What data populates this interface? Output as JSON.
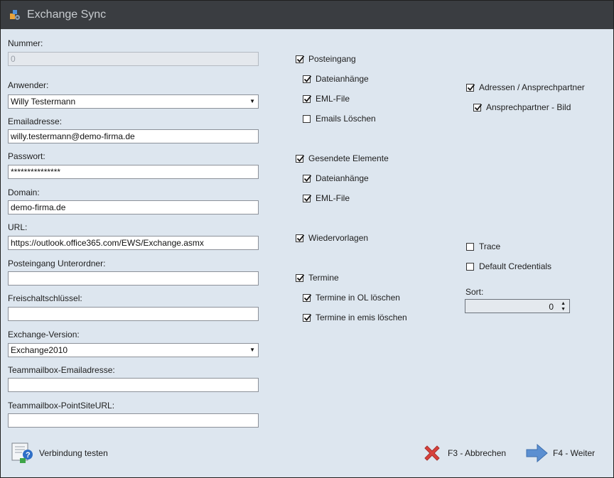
{
  "window": {
    "title": "Exchange Sync"
  },
  "form": {
    "nummer": {
      "label": "Nummer:",
      "value": "0"
    },
    "anwender": {
      "label": "Anwender:",
      "value": "Willy Testermann"
    },
    "email": {
      "label": "Emailadresse:",
      "value": "willy.testermann@demo-firma.de"
    },
    "passwort": {
      "label": "Passwort:",
      "value": "***************"
    },
    "domain": {
      "label": "Domain:",
      "value": "demo-firma.de"
    },
    "url": {
      "label": "URL:",
      "value": "https://outlook.office365.com/EWS/Exchange.asmx"
    },
    "posteingang_unterordner": {
      "label": "Posteingang Unterordner:",
      "value": ""
    },
    "freischaltschluessel": {
      "label": "Freischaltschlüssel:",
      "value": ""
    },
    "exchange_version": {
      "label": "Exchange-Version:",
      "value": "Exchange2010"
    },
    "teammailbox_email": {
      "label": "Teammailbox-Emailadresse:",
      "value": ""
    },
    "teammailbox_url": {
      "label": "Teammailbox-PointSiteURL:",
      "value": ""
    }
  },
  "options": {
    "posteingang": {
      "label": "Posteingang",
      "checked": true
    },
    "posteingang_anhaenge": {
      "label": "Dateianhänge",
      "checked": true
    },
    "posteingang_eml": {
      "label": "EML-File",
      "checked": true
    },
    "emails_loeschen": {
      "label": "Emails Löschen",
      "checked": false
    },
    "gesendete": {
      "label": "Gesendete Elemente",
      "checked": true
    },
    "gesendete_anhaenge": {
      "label": "Dateianhänge",
      "checked": true
    },
    "gesendete_eml": {
      "label": "EML-File",
      "checked": true
    },
    "wiedervorlagen": {
      "label": "Wiedervorlagen",
      "checked": true
    },
    "termine": {
      "label": "Termine",
      "checked": true
    },
    "termine_ol_loeschen": {
      "label": "Termine in OL löschen",
      "checked": true
    },
    "termine_emis_loeschen": {
      "label": "Termine in emis löschen",
      "checked": true
    },
    "adressen": {
      "label": "Adressen / Ansprechpartner",
      "checked": true
    },
    "ansprechpartner_bild": {
      "label": "Ansprechpartner - Bild",
      "checked": true
    },
    "trace": {
      "label": "Trace",
      "checked": false
    },
    "default_credentials": {
      "label": "Default Credentials",
      "checked": false
    },
    "sort": {
      "label": "Sort:",
      "value": "0"
    }
  },
  "footer": {
    "test_label": "Verbindung testen",
    "cancel_label": "F3 - Abbrechen",
    "next_label": "F4 - Weiter"
  },
  "colors": {
    "titlebar": "#3a3d41",
    "background": "#dde6ef",
    "cancel_red": "#d9413c",
    "next_blue": "#5b8fd1"
  }
}
